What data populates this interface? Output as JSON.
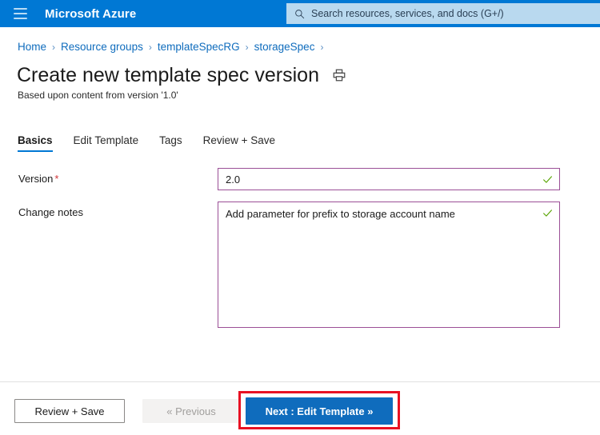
{
  "topbar": {
    "menu_icon": "hamburger-icon",
    "brand": "Microsoft Azure",
    "search": {
      "icon": "search-icon",
      "placeholder": "Search resources, services, and docs (G+/)",
      "value": ""
    }
  },
  "breadcrumb": {
    "separator": "›",
    "items": [
      {
        "label": "Home"
      },
      {
        "label": "Resource groups"
      },
      {
        "label": "templateSpecRG"
      },
      {
        "label": "storageSpec"
      }
    ],
    "trailing_separator": "›"
  },
  "page": {
    "title": "Create new template spec version",
    "print_icon": "print-icon",
    "subtitle": "Based upon content from version '1.0'"
  },
  "tabs": [
    {
      "label": "Basics",
      "active": true
    },
    {
      "label": "Edit Template",
      "active": false
    },
    {
      "label": "Tags",
      "active": false
    },
    {
      "label": "Review + Save",
      "active": false
    }
  ],
  "form": {
    "version": {
      "label": "Version",
      "required_marker": "*",
      "value": "2.0",
      "placeholder": "",
      "valid_icon": "checkmark-icon"
    },
    "change_notes": {
      "label": "Change notes",
      "value": "Add parameter for prefix to storage account name",
      "placeholder": "",
      "valid_icon": "checkmark-icon"
    }
  },
  "footer": {
    "review_save_label": "Review + Save",
    "previous_label": "« Previous",
    "next_label": "Next : Edit Template »"
  },
  "annotation": {
    "highlight_color": "#e81123",
    "target": "next-edit-template-button"
  },
  "colors": {
    "header_blue": "#0078d4",
    "search_bg": "#b9d9ef",
    "link_blue": "#0f6cbd",
    "input_border_purple": "#9b4f96",
    "valid_green": "#57a300",
    "required_red": "#d13438",
    "primary_button": "#0f6cbd",
    "disabled_button_bg": "#f3f2f1"
  }
}
